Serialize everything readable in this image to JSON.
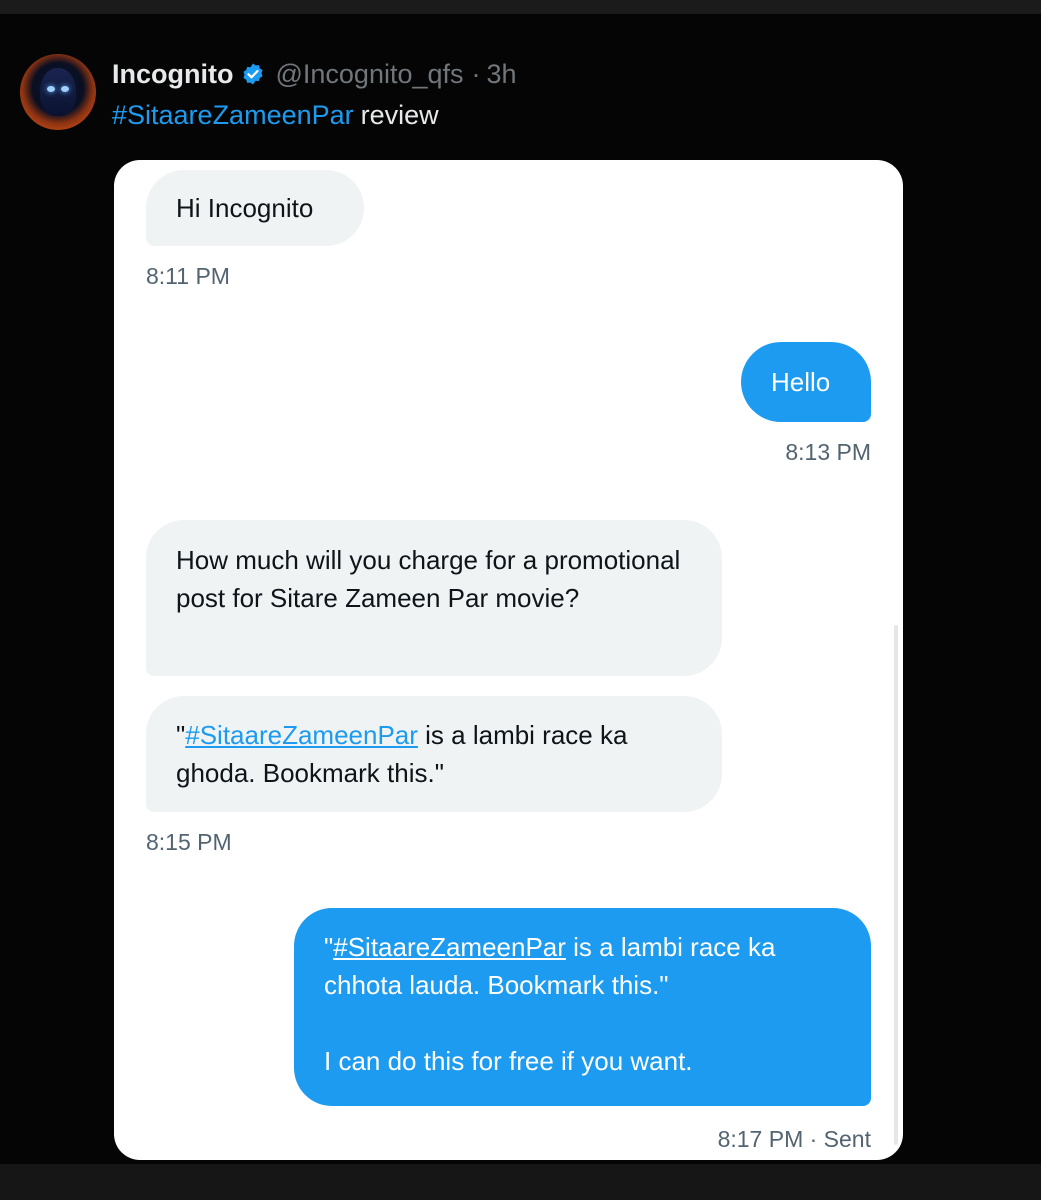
{
  "post": {
    "author_name": "Incognito",
    "handle": "@Incognito_qfs",
    "separator": "·",
    "age": "3h",
    "hashtag": "#SitaareZameenPar",
    "text": "review"
  },
  "icons": {
    "verified": "verified-badge-icon",
    "avatar": "avatar-image"
  },
  "colors": {
    "accent": "#1d9bf0",
    "incoming_bubble": "#eff3f4",
    "background": "#000000"
  },
  "dm": {
    "messages": [
      {
        "direction": "in",
        "text": "Hi Incognito"
      },
      {
        "direction": "out",
        "text": "Hello"
      },
      {
        "direction": "in",
        "text": "How much will you charge for a promotional post for Sitare Zameen Par movie?"
      },
      {
        "direction": "in",
        "quote_open": "\"",
        "hashtag": "#SitaareZameenPar",
        "text": " is a lambi race ka ghoda. Bookmark this.\""
      },
      {
        "direction": "out",
        "quote_open": "\"",
        "hashtag": "#SitaareZameenPar",
        "text": " is a lambi race ka chhota lauda. Bookmark this.\"",
        "text2": "I can do this for free if you want."
      }
    ],
    "timestamps": [
      "8:11 PM",
      "8:13 PM",
      "8:15 PM",
      "8:17 PM · Sent"
    ]
  }
}
